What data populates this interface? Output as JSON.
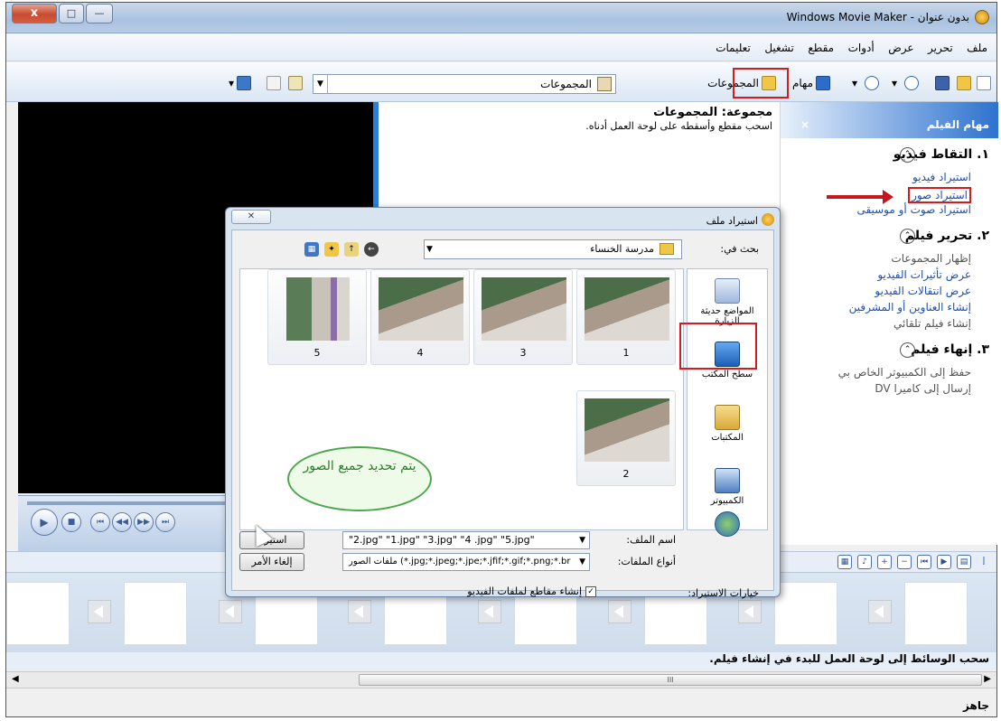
{
  "window": {
    "title": "بدون عنوان - Windows Movie Maker",
    "close_label": "x",
    "max_label": "□",
    "min_label": "—"
  },
  "menu": [
    "ملف",
    "تحرير",
    "عرض",
    "أدوات",
    "مقطع",
    "تشغيل",
    "تعليمات"
  ],
  "toolbar": {
    "tasks_label": "مهام",
    "collections_label": "المجموعات",
    "combo_value": "المجموعات"
  },
  "collection": {
    "heading": "مجموعة: المجموعات",
    "subtitle": "اسحب مقطع وأسقطه على لوحة العمل أدناه."
  },
  "tasks_pane": {
    "title": "مهام الفيلم",
    "close": "×",
    "sections": [
      {
        "title": "١. التقاط فيديو",
        "items": [
          {
            "label": "استيراد فيديو",
            "grey": false
          },
          {
            "label": "استيراد صور",
            "grey": false
          },
          {
            "label": "استيراد صوت أو موسيقى",
            "grey": false
          }
        ]
      },
      {
        "title": "٢. تحرير فيلم",
        "items": [
          {
            "label": "إظهار المجموعات",
            "grey": true
          },
          {
            "label": "عرض تأثيرات الفيديو",
            "grey": false
          },
          {
            "label": "عرض انتقالات الفيديو",
            "grey": false
          },
          {
            "label": "إنشاء العناوين أو المشرفين",
            "grey": false
          },
          {
            "label": "إنشاء فيلم تلقائي",
            "grey": true
          }
        ]
      },
      {
        "title": "٣. إنهاء فيلم",
        "items": [
          {
            "label": "حفظ إلى الكمبيوتر الخاص بي",
            "grey": true
          },
          {
            "label": "إرسال إلى كاميرا DV",
            "grey": true
          }
        ]
      }
    ]
  },
  "player": {
    "play": "▶",
    "stop": "■",
    "prev": "⏮",
    "back": "◀◀",
    "fwd": "▶▶",
    "next": "⏭"
  },
  "storyboard": {
    "hint": "سحب الوسائط إلى لوحة العمل للبدء في إنشاء فيلم.",
    "tb_label": "إ"
  },
  "scroll": {
    "thumb_grip": "III",
    "left": "◀",
    "right": "▶"
  },
  "status": "جاهز",
  "dialog": {
    "title": "استيراد ملف",
    "close": "✕",
    "lookin_label": "بحث في:",
    "lookin_value": "مدرسة الخنساء",
    "places": [
      "المواضع حديثة الزيارة",
      "سطح المكتب",
      "المكتبات",
      "الكمبيوتر"
    ],
    "thumbnails": [
      "1",
      "3",
      "4",
      "5",
      "2"
    ],
    "callout": "يتم تحديد جميع الصور",
    "filename_label": "اسم الملف:",
    "filename_value": "\"2.jpg\" \"1.jpg\" \"3.jpg\" \"4 .jpg\" \"5.jpg\"",
    "filetype_label": "أنواع الملفات:",
    "filetype_value": "ملفات الصور (*.jpg;*.jpeg;*.jpe;*.jfif;*.gif;*.png;*.br",
    "import_button": "استيراد",
    "cancel_button": "إلغاء الأمر",
    "options_label": "خيارات الاستيراد:",
    "options_checkbox": "إنشاء مقاطع لملفات الفيديو",
    "check_mark": "✓"
  },
  "colors": {
    "highlight": "#d31b22",
    "link": "#1b4fb5",
    "callout_green": "#2a7d2a"
  }
}
